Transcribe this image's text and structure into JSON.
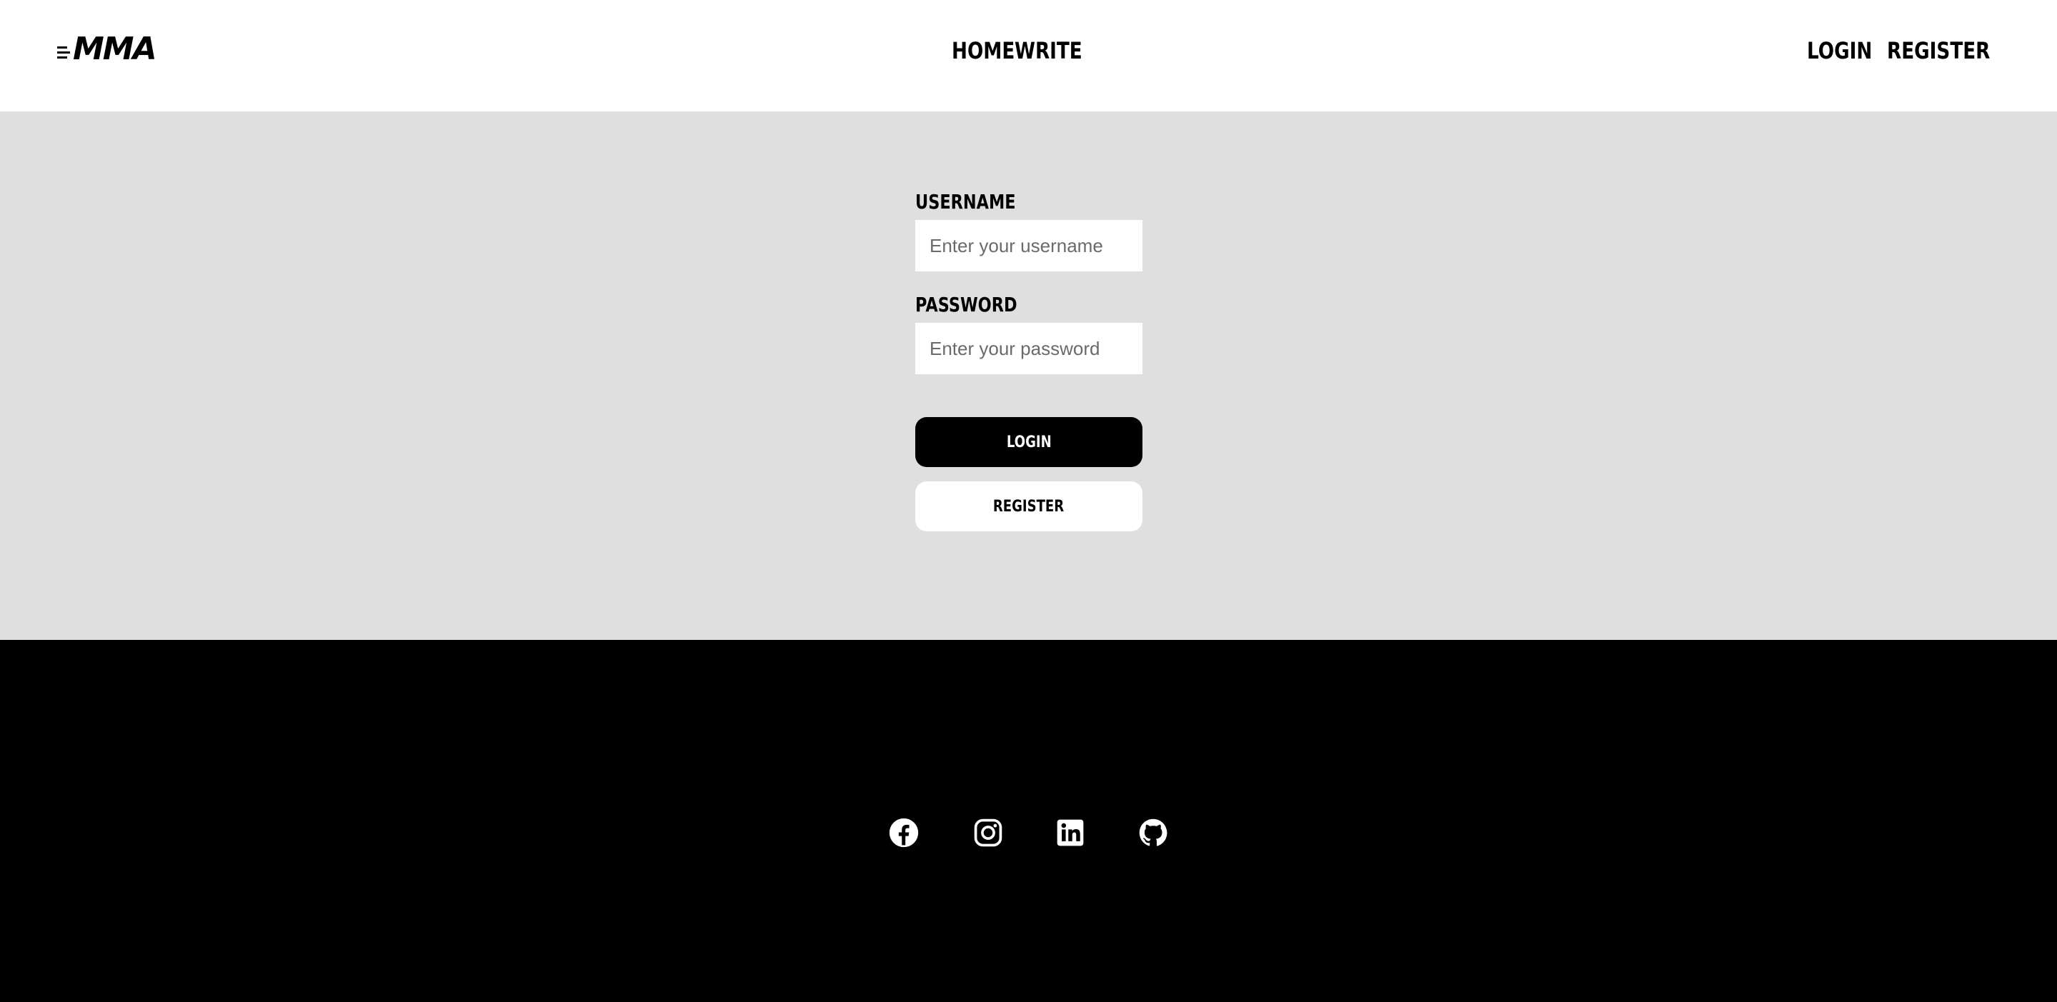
{
  "header": {
    "logo_text": "MMA",
    "nav": {
      "home": "HOME",
      "write": "WRITE"
    },
    "auth": {
      "login": "LOGIN",
      "register": "REGISTER"
    }
  },
  "form": {
    "username_label": "USERNAME",
    "username_placeholder": "Enter your username",
    "password_label": "PASSWORD",
    "password_placeholder": "Enter your password",
    "login_button": "LOGIN",
    "register_button": "REGISTER"
  },
  "footer": {
    "social_icons": [
      "facebook-icon",
      "instagram-icon",
      "linkedin-icon",
      "github-icon"
    ]
  },
  "colors": {
    "header_bg": "#ffffff",
    "main_bg": "#dfdfdf",
    "footer_bg": "#000000",
    "primary_button": "#000000",
    "secondary_button": "#ffffff"
  }
}
